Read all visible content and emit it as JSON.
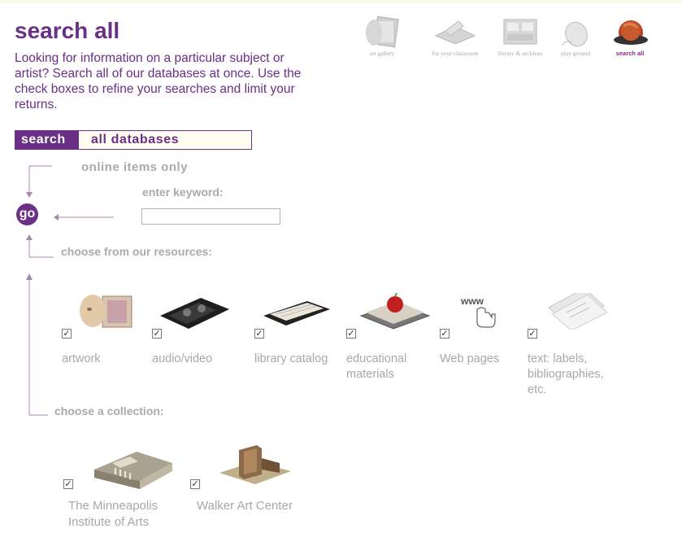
{
  "page": {
    "title": "search all",
    "intro": "Looking for information on a particular subject or artist? Search all of our databases at once. Use the check boxes to refine your searches and limit your returns."
  },
  "nav": [
    {
      "label": "art gallery",
      "icon": "art-gallery-icon"
    },
    {
      "label": "for your classroom",
      "icon": "classroom-icon"
    },
    {
      "label": "library & archives",
      "icon": "library-archives-icon"
    },
    {
      "label": "play ground",
      "icon": "mouse-playground-icon"
    },
    {
      "label": "search all",
      "icon": "globe-search-icon",
      "active": true
    }
  ],
  "search": {
    "label": "search",
    "scope": "all databases",
    "online_only": "online items only",
    "keyword_label": "enter keyword:",
    "keyword_value": "",
    "go": "go"
  },
  "resources": {
    "heading": "choose from our resources:",
    "items": [
      {
        "label": "artwork",
        "checked": true,
        "icon": "artwork-icon"
      },
      {
        "label": "audio/video",
        "checked": true,
        "icon": "videotape-icon"
      },
      {
        "label": "library catalog",
        "checked": true,
        "icon": "card-catalog-icon"
      },
      {
        "label": "educational materials",
        "checked": true,
        "icon": "books-apple-icon"
      },
      {
        "label": "Web pages",
        "checked": true,
        "icon": "www-hand-icon"
      },
      {
        "label": "text: labels, bibliographies, etc.",
        "checked": true,
        "icon": "text-pages-icon"
      }
    ]
  },
  "collections": {
    "heading": "choose a collection:",
    "items": [
      {
        "label": "The Minneapolis Institute of Arts",
        "checked": true,
        "icon": "mia-building-icon"
      },
      {
        "label": "Walker Art Center",
        "checked": true,
        "icon": "walker-building-icon"
      }
    ]
  },
  "colors": {
    "accent": "#6a2f86",
    "muted": "#aaaaaa",
    "nav_active": "#8a2a8a"
  }
}
